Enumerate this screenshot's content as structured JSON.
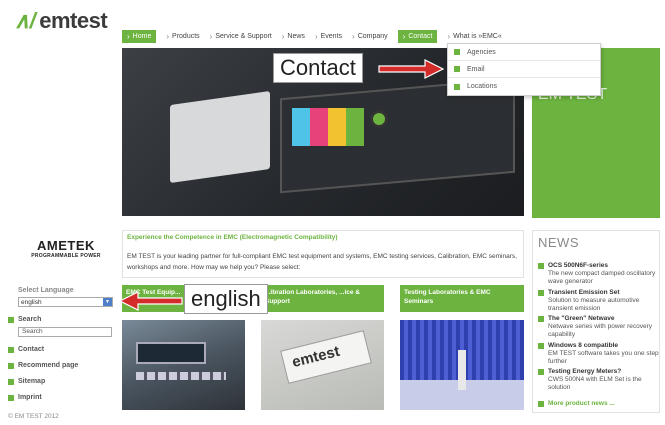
{
  "logo": {
    "mark": "∧/",
    "text": "emtest"
  },
  "nav": {
    "items": [
      {
        "label": "Home",
        "state": "active"
      },
      {
        "label": "Products",
        "state": ""
      },
      {
        "label": "Service & Support",
        "state": ""
      },
      {
        "label": "News",
        "state": ""
      },
      {
        "label": "Events",
        "state": ""
      },
      {
        "label": "Company",
        "state": ""
      },
      {
        "label": "Contact",
        "state": "open"
      },
      {
        "label": "What is »EMC«",
        "state": ""
      }
    ],
    "chevron": "›"
  },
  "contact_dropdown": {
    "items": [
      {
        "label": "Agencies"
      },
      {
        "label": "Email"
      },
      {
        "label": "Locations"
      }
    ]
  },
  "hero": {
    "screen_colors": [
      "#4fc3e8",
      "#e8427a",
      "#f2c230",
      "#6cb33f"
    ]
  },
  "welcome_banner": {
    "line1": "… E TO",
    "line2": "EM TEST"
  },
  "sidebar": {
    "ametek_brand": "AMETEK",
    "ametek_sub": "PROGRAMMABLE POWER",
    "language_label": "Select Language",
    "language_value": "english",
    "language_arrow": "▼",
    "search_link": "Search",
    "search_input_value": "Search",
    "links": [
      {
        "label": "Contact"
      },
      {
        "label": "Recommend page"
      },
      {
        "label": "Sitemap"
      },
      {
        "label": "Imprint"
      }
    ],
    "copyright": "© EM TEST 2012"
  },
  "intro": {
    "title": "Experience the Competence in EMC (Electromagnetic Compatibility)",
    "text": "EM TEST is your leading partner for full-compliant EMC test equipment and systems, EMC testing services, Calibration, EMC seminars, workshops and more. How may we help you? Please select:"
  },
  "cards": [
    {
      "title": "EMC Test Equip..."
    },
    {
      "title": "...ibration Laboratories, ...ice & Support"
    },
    {
      "title": "Testing Laboratories & EMC Seminars"
    }
  ],
  "card_image_brand": "emtest",
  "news": {
    "title": "NEWS",
    "items": [
      {
        "title": "OCS 500N6F-series",
        "desc": "The new compact damped oscillatory wave generator"
      },
      {
        "title": "Transient Emission Set",
        "desc": "Solution to measure automotive transient emission"
      },
      {
        "title": "The \"Green\" Netwave",
        "desc": "Netwave series with power recovery capability"
      },
      {
        "title": "Windows 8 compatible",
        "desc": "EM TEST software takes you one step further"
      },
      {
        "title": "Testing Energy Meters?",
        "desc": "CWS 500N4 with ELM Set is the solution"
      }
    ],
    "more": "More product news ..."
  },
  "annotations": {
    "contact_callout": "Contact",
    "english_callout": "english",
    "arrow_color": "#d42b2b"
  },
  "colors": {
    "accent": "#6cb33f"
  }
}
